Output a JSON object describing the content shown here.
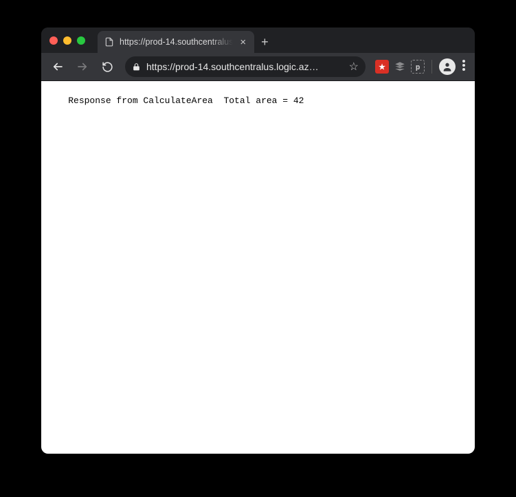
{
  "window": {
    "traffic_lights": [
      "close",
      "minimize",
      "maximize"
    ]
  },
  "tab": {
    "title": "https://prod-14.southcentralus",
    "favicon": "page-icon"
  },
  "toolbar": {
    "back": "Back",
    "forward": "Forward",
    "reload": "Reload",
    "new_tab": "+"
  },
  "addressbar": {
    "secure": true,
    "url_display": "https://prod-14.southcentralus.logic.az…"
  },
  "extensions": [
    {
      "name": "extension-red",
      "glyph": "★"
    },
    {
      "name": "extension-stack",
      "glyph": "≋"
    },
    {
      "name": "extension-boxed",
      "glyph": "p"
    }
  ],
  "actions": {
    "bookmark": "☆",
    "profile": "Profile",
    "menu": "⋮"
  },
  "page": {
    "body_text": "Response from CalculateArea  Total area = 42"
  }
}
